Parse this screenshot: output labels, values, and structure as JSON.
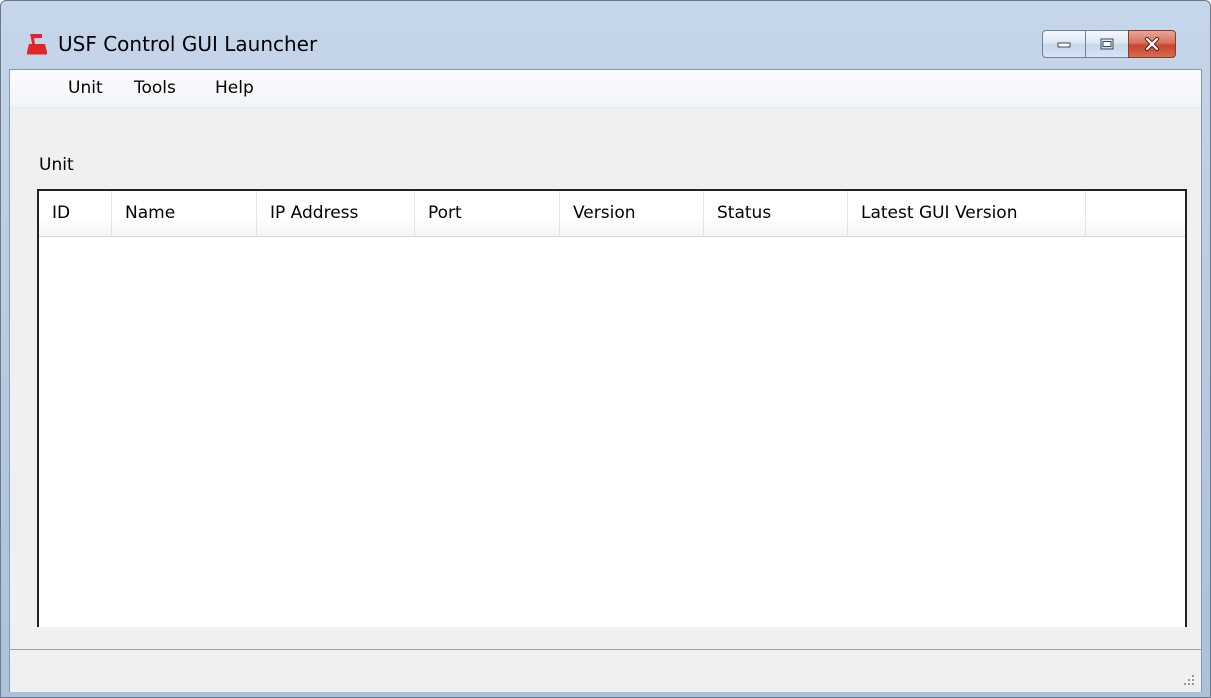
{
  "window": {
    "title": "USF Control GUI Launcher",
    "icon": "usf-app-icon",
    "accent_icon_color": "#e0262a"
  },
  "caption_buttons": {
    "minimize_icon": "minimize-icon",
    "maximize_icon": "maximize-icon",
    "close_icon": "close-icon"
  },
  "menu": {
    "items": [
      {
        "label": "Unit"
      },
      {
        "label": "Tools"
      },
      {
        "label": "Help"
      }
    ]
  },
  "unit_section": {
    "label": "Unit"
  },
  "unit_table": {
    "columns": [
      "ID",
      "Name",
      "IP Address",
      "Port",
      "Version",
      "Status",
      "Latest GUI Version"
    ],
    "rows": []
  }
}
